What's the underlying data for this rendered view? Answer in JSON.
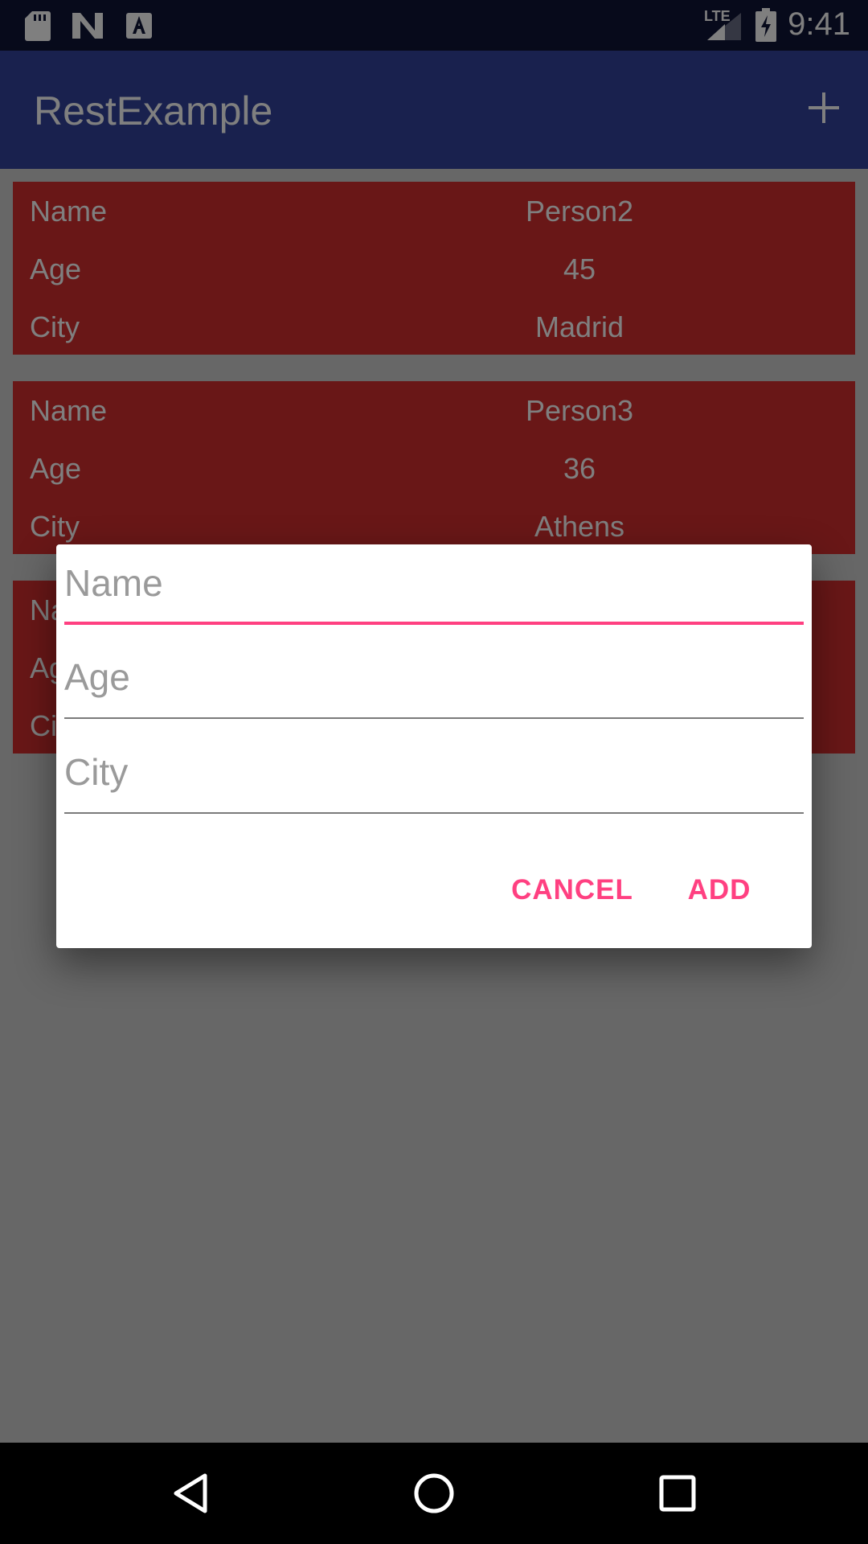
{
  "status_bar": {
    "time": "9:41",
    "network_label": "LTE",
    "icons": [
      "sd-card-icon",
      "n-logo-icon",
      "a-notification-icon",
      "signal-icon",
      "battery-charging-icon"
    ]
  },
  "app_bar": {
    "title": "RestExample",
    "action_icon": "plus-icon"
  },
  "cards": [
    {
      "rows": [
        {
          "label": "Name",
          "value": "Person2"
        },
        {
          "label": "Age",
          "value": "45"
        },
        {
          "label": "City",
          "value": "Madrid"
        }
      ]
    },
    {
      "rows": [
        {
          "label": "Name",
          "value": "Person3"
        },
        {
          "label": "Age",
          "value": "36"
        },
        {
          "label": "City",
          "value": "Athens"
        }
      ]
    },
    {
      "rows": [
        {
          "label": "Na",
          "value": ""
        },
        {
          "label": "Ag",
          "value": ""
        },
        {
          "label": "Ci",
          "value": ""
        }
      ]
    }
  ],
  "dialog": {
    "fields": [
      {
        "placeholder": "Name",
        "value": "",
        "focused": true
      },
      {
        "placeholder": "Age",
        "value": ""
      },
      {
        "placeholder": "City",
        "value": ""
      }
    ],
    "cancel_label": "CANCEL",
    "add_label": "ADD"
  },
  "colors": {
    "status_bar": "#0f1536",
    "app_bar": "#33439c",
    "card": "#d32f2f",
    "accent": "#ff4081",
    "scrim": "rgba(0,0,0,0.5)"
  },
  "nav_bar": {
    "icons": [
      "back-icon",
      "home-icon",
      "recents-icon"
    ]
  }
}
